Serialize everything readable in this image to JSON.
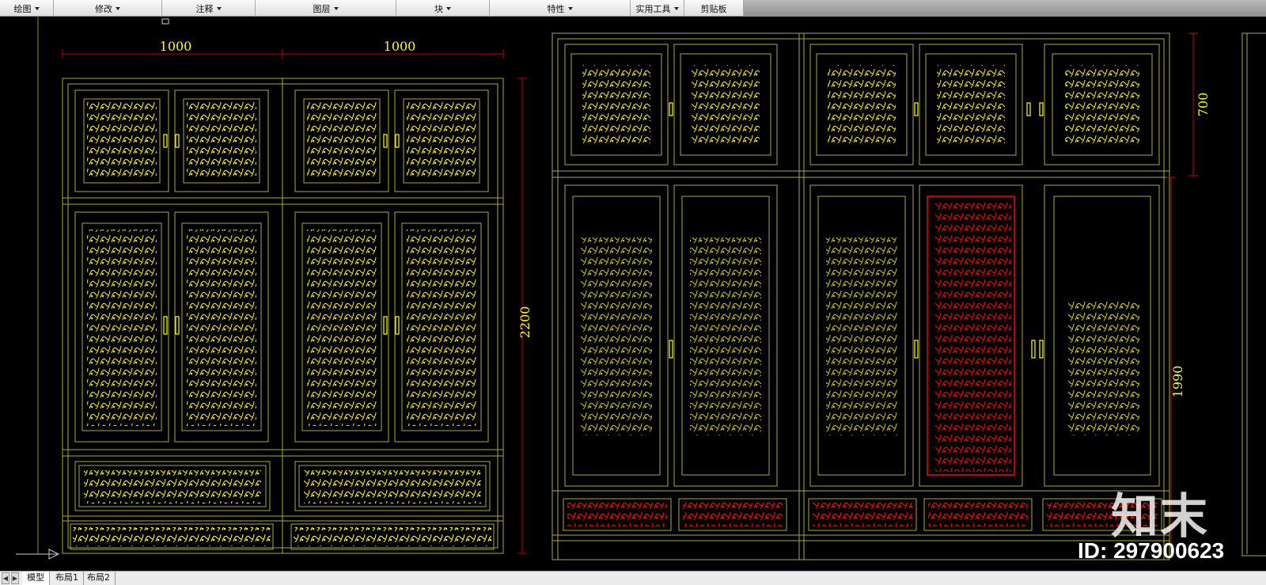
{
  "ribbon": {
    "panels": [
      {
        "label": "绘图"
      },
      {
        "label": "修改"
      },
      {
        "label": "注释"
      },
      {
        "label": "图层"
      },
      {
        "label": "块"
      },
      {
        "label": "特性"
      },
      {
        "label": "实用工具"
      },
      {
        "label": "剪贴板"
      }
    ]
  },
  "drawing": {
    "dimensions": {
      "left_width_a": "1000",
      "left_width_b": "1000",
      "left_height": "2200",
      "right_top_height": "700",
      "right_lower_height": "1990"
    },
    "colors": {
      "background": "#000000",
      "frame_lines": "#a8a83a",
      "carving_yellow": "#ffff00",
      "carving_red": "#ff0000",
      "dimension_red": "#c00000"
    }
  },
  "watermark": {
    "logo": "知末",
    "id_text": "ID: 297900623"
  },
  "layout_tabs": {
    "items": [
      {
        "label": "模型"
      },
      {
        "label": "布局1"
      },
      {
        "label": "布局2"
      }
    ]
  }
}
